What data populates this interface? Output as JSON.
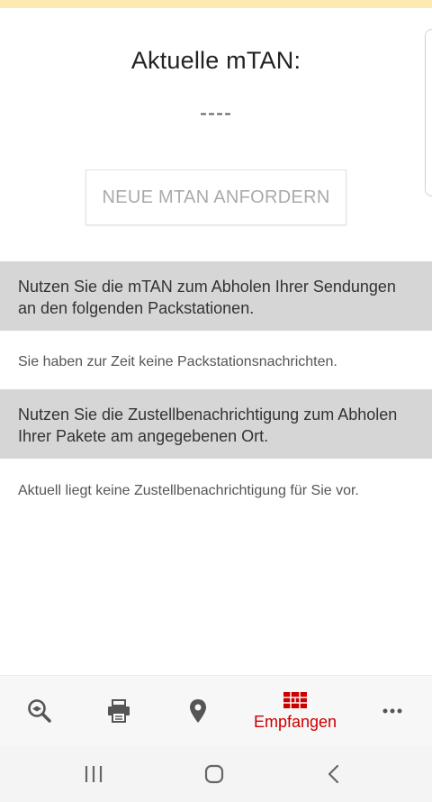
{
  "screen": {
    "title": "Aktuelle mTAN:",
    "mtan_value": "----",
    "request_button_label": "NEUE MTAN ANFORDERN"
  },
  "sections": [
    {
      "header": "Nutzen Sie die mTAN zum Abholen Ihrer Sendungen an den folgenden Packstationen.",
      "info": "Sie haben zur Zeit keine Packstationsnachrichten."
    },
    {
      "header": "Nutzen Sie die Zustellbenachrichtigung zum Abholen Ihrer Pakete am angegebenen Ort.",
      "info": "Aktuell liegt keine Zustellbenachrichtigung für Sie vor."
    }
  ],
  "bottom_nav": {
    "items": [
      {
        "icon": "search-tracking-icon"
      },
      {
        "icon": "printer-icon"
      },
      {
        "icon": "location-pin-icon"
      },
      {
        "icon": "packstation-icon",
        "label": "Empfangen",
        "active": true
      },
      {
        "icon": "more-icon"
      }
    ],
    "active_color": "#cc0000",
    "icon_color": "#555555"
  },
  "system_nav": {
    "buttons": [
      "recent-apps-icon",
      "home-icon",
      "back-icon"
    ]
  }
}
